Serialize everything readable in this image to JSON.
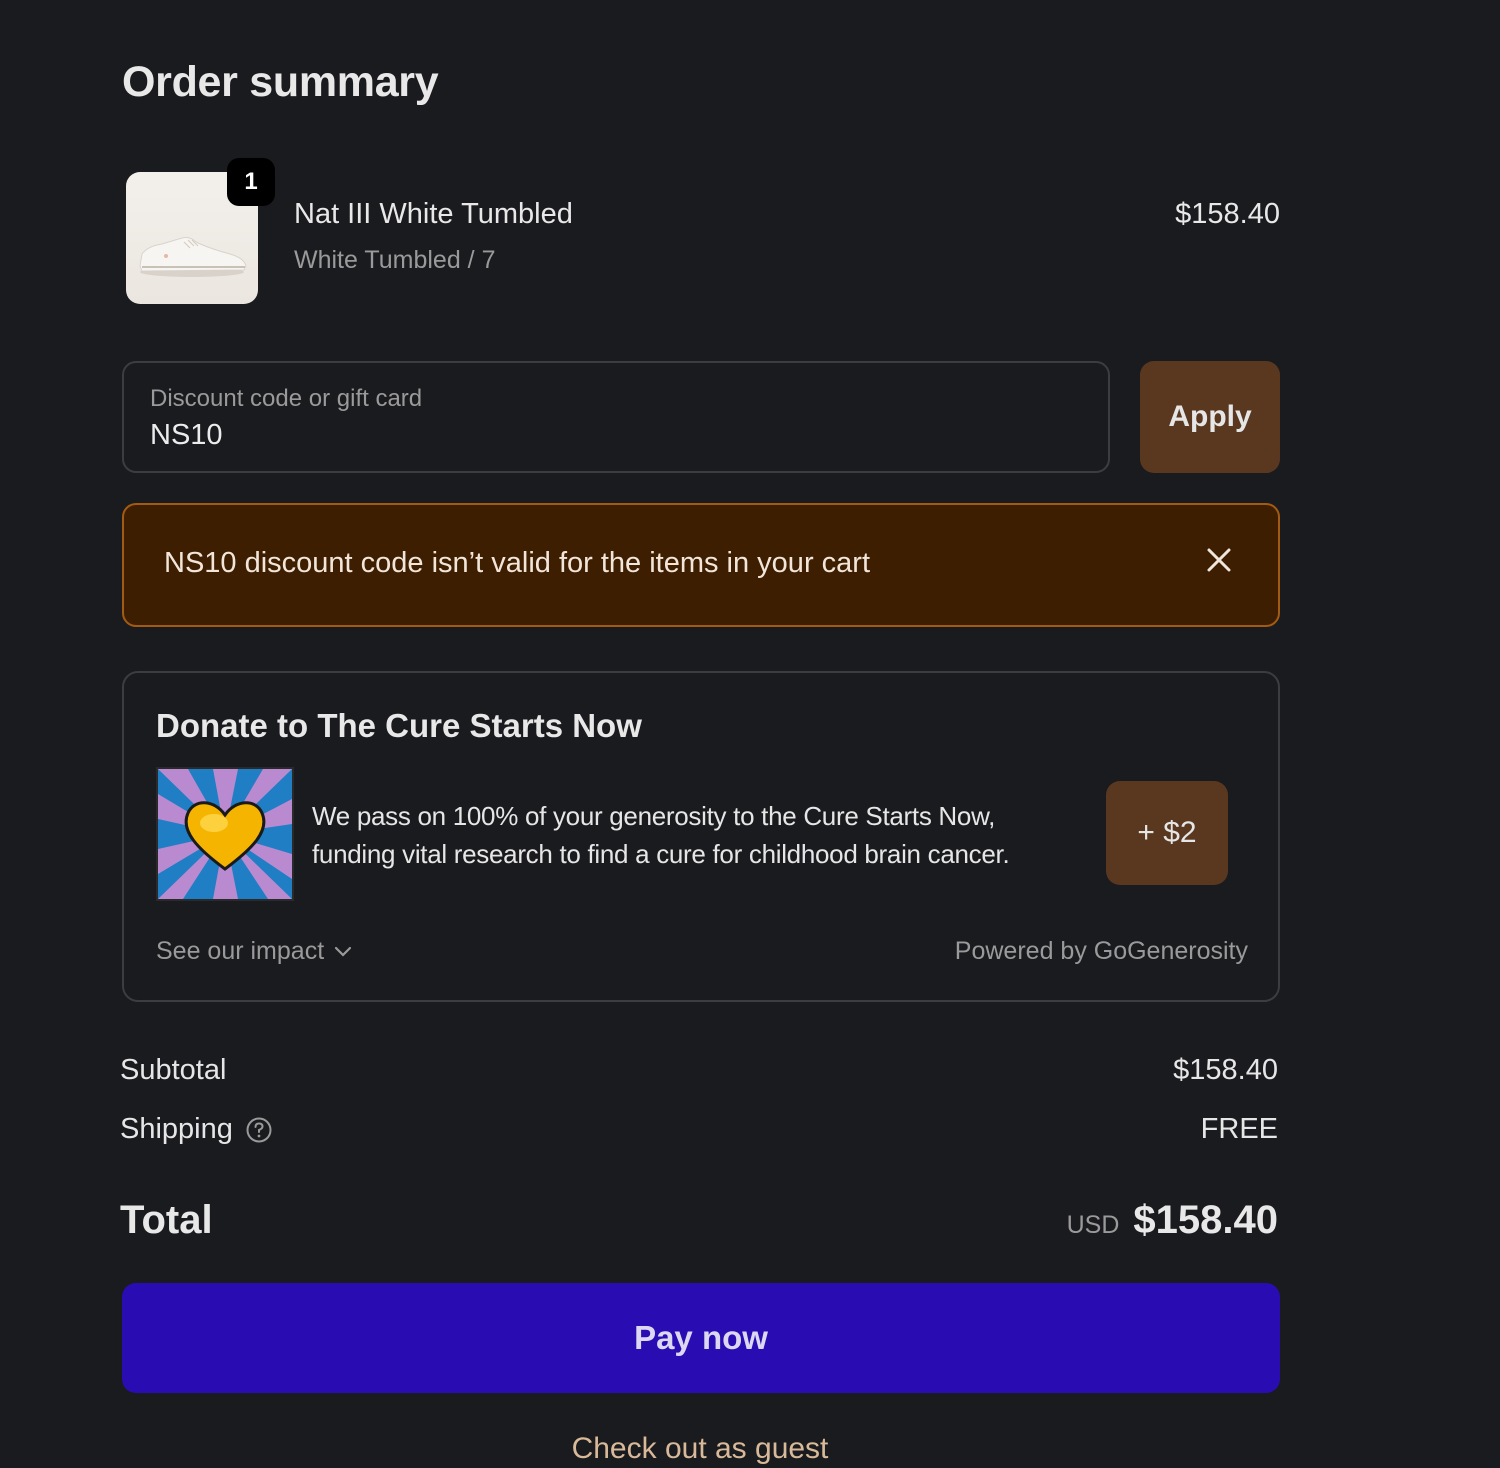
{
  "page": {
    "title": "Order summary"
  },
  "product": {
    "quantity": "1",
    "name": "Nat III White Tumbled",
    "variant": "White Tumbled / 7",
    "price": "$158.40",
    "image_icon": "shoe-image"
  },
  "discount": {
    "label": "Discount code or gift card",
    "value": "NS10",
    "apply_label": "Apply"
  },
  "error": {
    "message": "NS10 discount code isn’t valid for the items in your cart",
    "close_icon": "close-icon"
  },
  "donation": {
    "title": "Donate to The Cure Starts Now",
    "description_line1": "We pass on 100% of your generosity to the Cure Starts Now,",
    "description_line2": "funding vital research to find a cure for childhood brain cancer.",
    "button_label": "+ $2",
    "impact_link": "See our impact",
    "powered_by": "Powered by GoGenerosity"
  },
  "summary": {
    "subtotal_label": "Subtotal",
    "subtotal_value": "$158.40",
    "shipping_label": "Shipping",
    "shipping_value": "FREE",
    "total_label": "Total",
    "currency": "USD",
    "total_value": "$158.40"
  },
  "actions": {
    "pay_label": "Pay now",
    "guest_label": "Check out as guest"
  },
  "colors": {
    "background": "#1a1b1e",
    "accent_brown": "#5a3820",
    "error_bg": "#3e1e00",
    "error_border": "#a35a12",
    "pay_button": "#2a0db2",
    "guest_link": "#d8b99a"
  }
}
